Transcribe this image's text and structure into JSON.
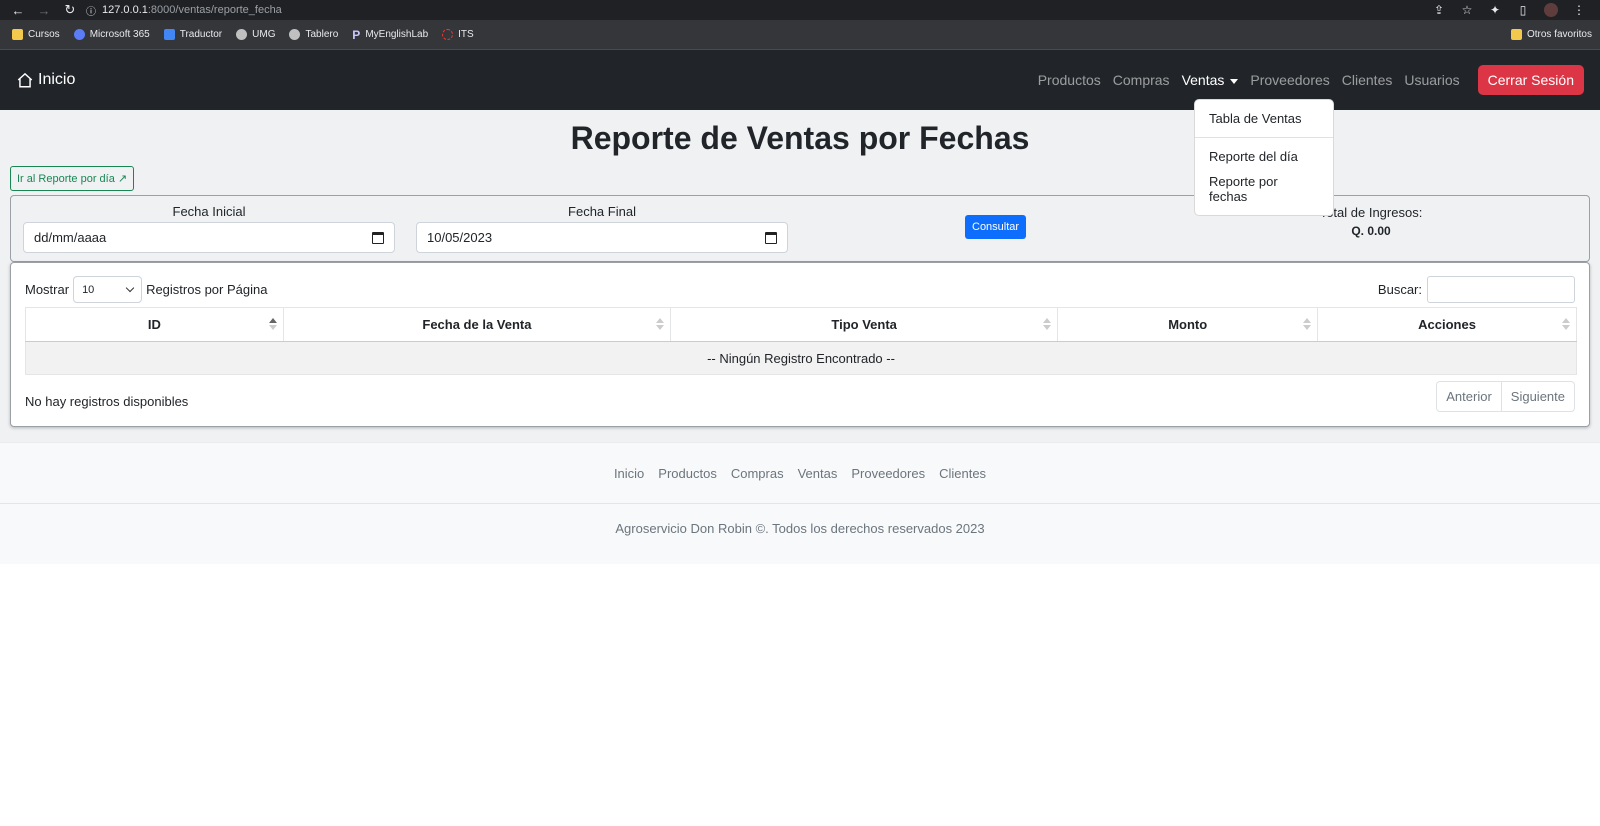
{
  "browser": {
    "url_host": "127.0.0.1",
    "url_path": ":8000/ventas/reporte_fecha",
    "bookmarks": [
      {
        "label": "Cursos",
        "color": "#f2c94c"
      },
      {
        "label": "Microsoft 365",
        "color": "#5b7cf5"
      },
      {
        "label": "Traductor",
        "color": "#4285f4"
      },
      {
        "label": "UMG",
        "color": "#c0c0c0"
      },
      {
        "label": "Tablero",
        "color": "#c0c0c0"
      },
      {
        "label": "MyEnglishLab",
        "color": "#1a1a6e"
      },
      {
        "label": "ITS",
        "color": "#e53935"
      }
    ],
    "other_bookmarks": "Otros favoritos"
  },
  "navbar": {
    "brand": "Inicio",
    "links": [
      "Productos",
      "Compras",
      "Ventas",
      "Proveedores",
      "Clientes",
      "Usuarios"
    ],
    "logout": "Cerrar Sesión"
  },
  "dropdown": {
    "item1": "Tabla de Ventas",
    "item2": "Reporte del día",
    "item3": "Reporte por fechas"
  },
  "page": {
    "title": "Reporte de Ventas por Fechas",
    "report_day_button": "Ir al Reporte por día ↗"
  },
  "filters": {
    "start_label": "Fecha Inicial",
    "start_value": "dd/mm/aaaa",
    "end_label": "Fecha Final",
    "end_value": "10/05/2023",
    "submit": "Consultar",
    "total_label": "Total de Ingresos:",
    "total_value": "Q. 0.00"
  },
  "table": {
    "show_label": "Mostrar",
    "page_size": "10",
    "per_page_label": "Registros por Página",
    "search_label": "Buscar:",
    "columns": [
      "ID",
      "Fecha de la Venta",
      "Tipo Venta",
      "Monto",
      "Acciones"
    ],
    "empty_message": "-- Ningún Registro Encontrado --",
    "info": "No hay registros disponibles",
    "prev": "Anterior",
    "next": "Siguiente"
  },
  "footer": {
    "links": [
      "Inicio",
      "Productos",
      "Compras",
      "Ventas",
      "Proveedores",
      "Clientes"
    ],
    "copyright": "Agroservicio Don Robin ©. Todos los derechos reservados 2023"
  },
  "colors": {
    "navbar_bg": "#212529",
    "danger": "#dc3545",
    "primary": "#0d6efd",
    "success": "#198754"
  }
}
